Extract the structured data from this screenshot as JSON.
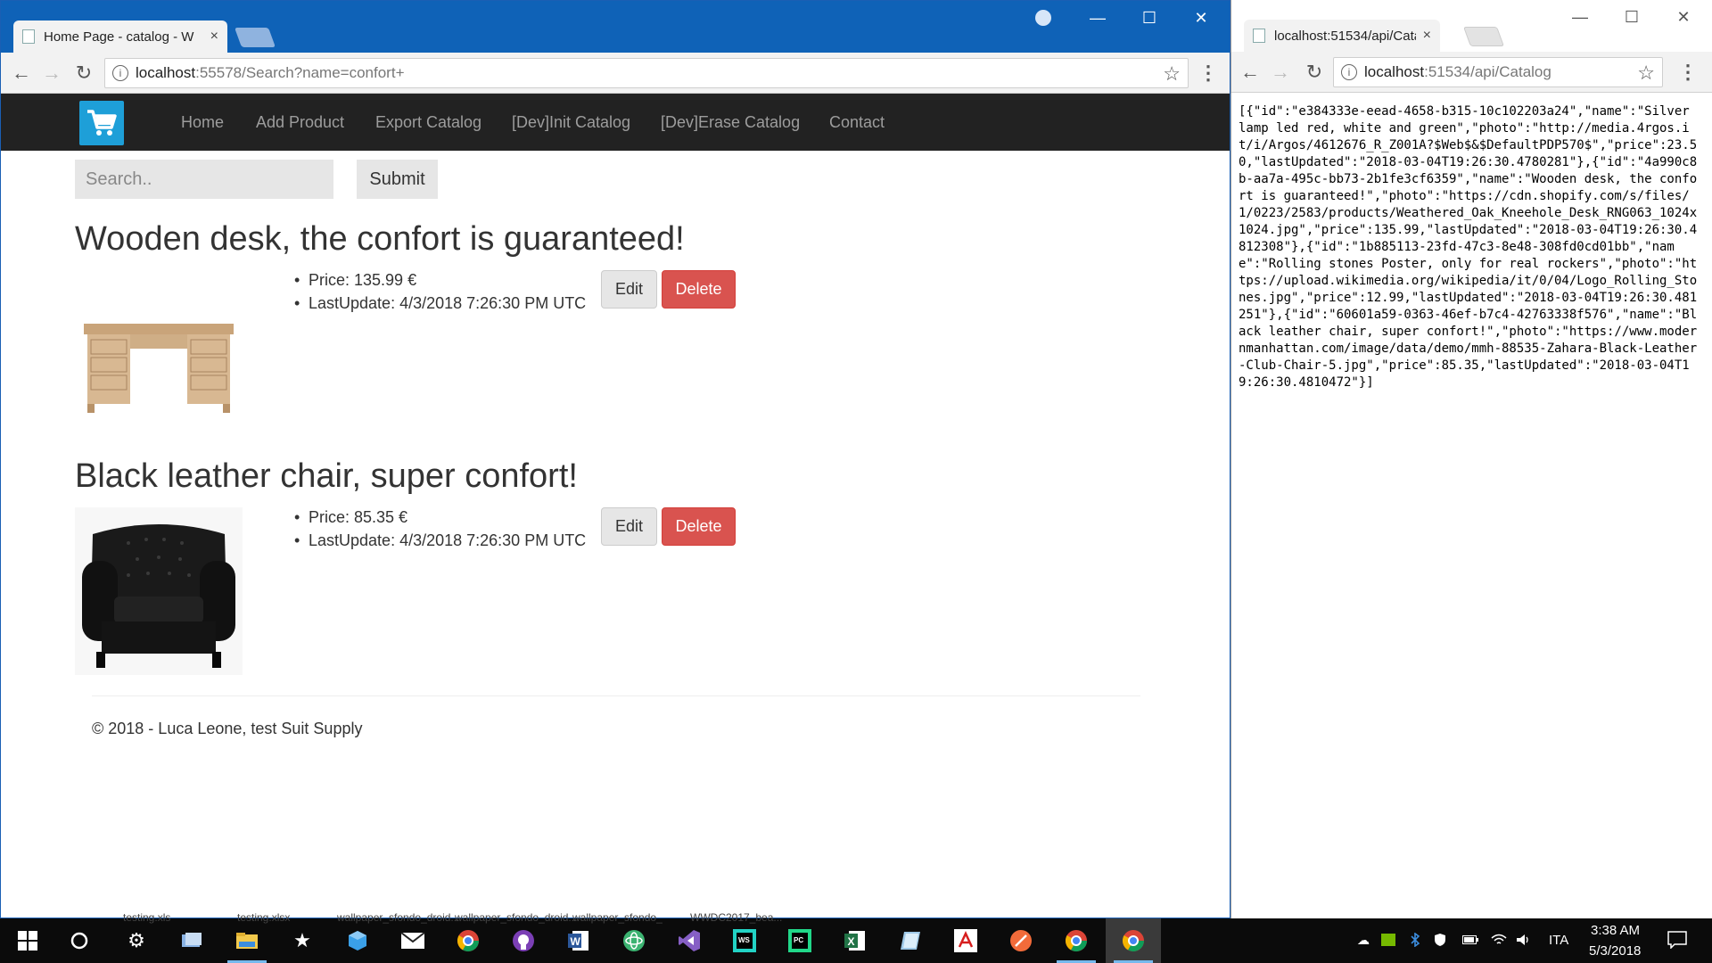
{
  "left_browser": {
    "tab_title": "Home Page - catalog - W",
    "tab_close": "×",
    "url_host": "localhost",
    "url_rest": ":55578/Search?name=confort+",
    "window_controls": {
      "minimize": "—",
      "maximize": "☐",
      "close": "✕"
    }
  },
  "site": {
    "nav": [
      "Home",
      "Add Product",
      "Export Catalog",
      "[Dev]Init Catalog",
      "[Dev]Erase Catalog",
      "Contact"
    ],
    "search_placeholder": "Search..",
    "submit_label": "Submit",
    "products": [
      {
        "title": "Wooden desk, the confort is guaranteed!",
        "price": "Price: 135.99 €",
        "last_update": "LastUpdate: 4/3/2018 7:26:30 PM UTC",
        "edit_label": "Edit",
        "delete_label": "Delete",
        "image": "wooden-desk"
      },
      {
        "title": "Black leather chair, super confort!",
        "price": "Price: 85.35 €",
        "last_update": "LastUpdate: 4/3/2018 7:26:30 PM UTC",
        "edit_label": "Edit",
        "delete_label": "Delete",
        "image": "black-leather-chair"
      }
    ],
    "footer": "© 2018 - Luca Leone, test Suit Supply",
    "colors": {
      "navbar": "#222222",
      "cart_logo": "#1e9fd8",
      "delete": "#d9534f",
      "chrome_frame": "#0f62b7"
    }
  },
  "right_browser": {
    "tab_title": "localhost:51534/api/Cata",
    "tab_close": "×",
    "url_host": "localhost",
    "url_rest": ":51534/api/Catalog",
    "json_text": "[{\"id\":\"e384333e-eead-4658-b315-10c102203a24\",\"name\":\"Silver lamp led red, white and green\",\"photo\":\"http://media.4rgos.it/i/Argos/4612676_R_Z001A?$Web$&$DefaultPDP570$\",\"price\":23.50,\"lastUpdated\":\"2018-03-04T19:26:30.4780281\"},{\"id\":\"4a990c8b-aa7a-495c-bb73-2b1fe3cf6359\",\"name\":\"Wooden desk, the confort is guaranteed!\",\"photo\":\"https://cdn.shopify.com/s/files/1/0223/2583/products/Weathered_Oak_Kneehole_Desk_RNG063_1024x1024.jpg\",\"price\":135.99,\"lastUpdated\":\"2018-03-04T19:26:30.4812308\"},{\"id\":\"1b885113-23fd-47c3-8e48-308fd0cd01bb\",\"name\":\"Rolling stones Poster, only for real rockers\",\"photo\":\"https://upload.wikimedia.org/wikipedia/it/0/04/Logo_Rolling_Stones.jpg\",\"price\":12.99,\"lastUpdated\":\"2018-03-04T19:26:30.481251\"},{\"id\":\"60601a59-0363-46ef-b7c4-42763338f576\",\"name\":\"Black leather chair, super confort!\",\"photo\":\"https://www.modernmanhattan.com/image/data/demo/mmh-88535-Zahara-Black-Leather-Club-Chair-5.jpg\",\"price\":85.35,\"lastUpdated\":\"2018-03-04T19:26:30.4810472\"}]"
  },
  "taskbar": {
    "desktop_labels": [
      "testing.xls",
      "testing.xlsx",
      "wallpaper_sfondo_droid...",
      "wallpaper_sfondo_droid...",
      "wallpaper_sfondo_",
      "WWDC2017_bea..."
    ],
    "language": "ITA",
    "time": "3:38 AM",
    "date": "5/3/2018"
  }
}
